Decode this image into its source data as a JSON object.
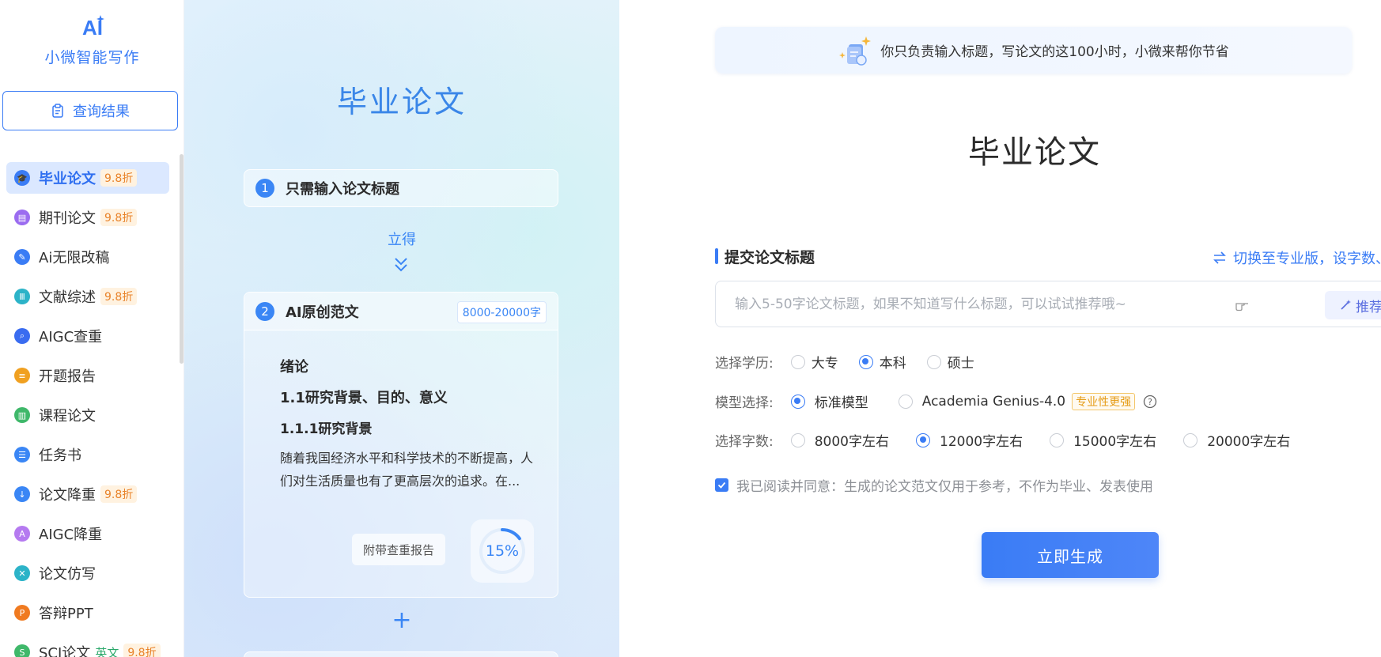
{
  "brand": {
    "logo_text": "AI",
    "name": "小微智能写作"
  },
  "sidebar": {
    "query_label": "查询结果",
    "items": [
      {
        "label": "毕业论文",
        "badge": "9.8折",
        "icon": "graduation-cap-icon",
        "color": "#3a7cf5",
        "active": true
      },
      {
        "label": "期刊论文",
        "badge": "9.8折",
        "icon": "journal-icon",
        "color": "#9b6cf0"
      },
      {
        "label": "Ai无限改稿",
        "badge": "",
        "icon": "pen-icon",
        "color": "#3a7cf5"
      },
      {
        "label": "文献综述",
        "badge": "9.8折",
        "icon": "library-icon",
        "color": "#2cb3c8"
      },
      {
        "label": "AIGC查重",
        "badge": "",
        "icon": "search-check-icon",
        "color": "#3a6cf0"
      },
      {
        "label": "开题报告",
        "badge": "",
        "icon": "report-icon",
        "color": "#f0a020"
      },
      {
        "label": "课程论文",
        "badge": "",
        "icon": "book-icon",
        "color": "#3fb86a"
      },
      {
        "label": "任务书",
        "badge": "",
        "icon": "task-icon",
        "color": "#3a86f5"
      },
      {
        "label": "论文降重",
        "badge": "9.8折",
        "icon": "reduce-icon",
        "color": "#3a86f5"
      },
      {
        "label": "AIGC降重",
        "badge": "",
        "icon": "ai-reduce-icon",
        "color": "#b57af0"
      },
      {
        "label": "论文仿写",
        "badge": "",
        "icon": "rewrite-icon",
        "color": "#2cb3c8"
      },
      {
        "label": "答辩PPT",
        "badge": "",
        "icon": "ppt-icon",
        "color": "#f07a20"
      },
      {
        "label": "SCI论文",
        "badge_green": "英文",
        "badge": "9.8折",
        "icon": "sci-icon",
        "color": "#3fb86a"
      }
    ]
  },
  "preview": {
    "title": "毕业论文",
    "step1": {
      "num": "1",
      "text": "只需输入论文标题"
    },
    "lide": "立得",
    "step2": {
      "num": "2",
      "text": "AI原创范文",
      "range": "8000-20000字"
    },
    "outline": {
      "h1": "绪论",
      "h2": "1.1研究背景、目的、意义",
      "h3": "1.1.1研究背景",
      "para": "随着我国经济水平和科学技术的不断提高，人们对生活质量也有了更高层次的追求。在..."
    },
    "report_tag": "附带查重报告",
    "percent_text": "15%",
    "percent": 15,
    "plus": "+"
  },
  "form": {
    "banner": "你只负责输入标题，写论文的这100小时，小微来帮你节省",
    "title": "毕业论文",
    "section_title": "提交论文标题",
    "switch_label": "切换至专业版，设字数、",
    "input_placeholder": "输入5-50字论文标题，如果不知道写什么标题，可以试试推荐哦~",
    "recommend_label": "推荐标题",
    "degree": {
      "label": "选择学历:",
      "options": [
        "大专",
        "本科",
        "硕士"
      ],
      "selected": "本科"
    },
    "model": {
      "label": "模型选择:",
      "options": [
        "标准模型",
        "Academia Genius-4.0"
      ],
      "selected": "标准模型",
      "tag": "专业性更强"
    },
    "words": {
      "label": "选择字数:",
      "options": [
        "8000字左右",
        "12000字左右",
        "15000字左右",
        "20000字左右"
      ],
      "selected": "12000字左右"
    },
    "agree_text": "我已阅读并同意：生成的论文范文仅用于参考，不作为毕业、发表使用",
    "submit_label": "立即生成"
  },
  "colors": {
    "accent": "#3a7cf5",
    "badge_orange": "#e9832a"
  }
}
